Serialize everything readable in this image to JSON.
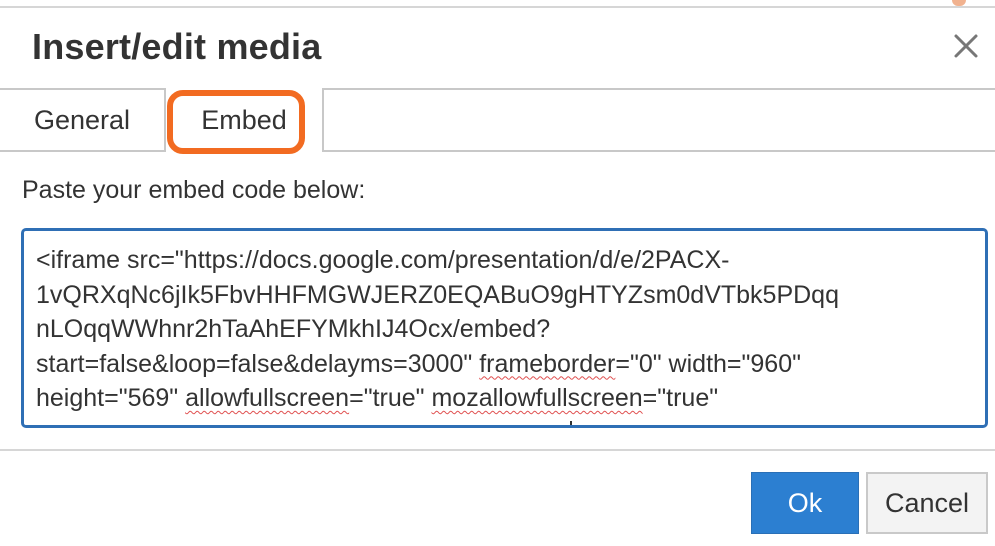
{
  "dialog": {
    "title": "Insert/edit media",
    "close_icon": "close-icon"
  },
  "tabs": [
    {
      "label": "General",
      "active": false
    },
    {
      "label": "Embed",
      "active": true
    }
  ],
  "embed": {
    "instruction": "Paste your embed code below:",
    "lines": {
      "l1": "<iframe src=\"https://docs.google.com/presentation/d/e/2PACX-",
      "l2": "1vQRXqNc6jIk5FbvHHFMGWJERZ0EQABuO9gHTYZsm0dVTbk5PDqq",
      "l3": "nLOqqWWhnr2hTaAhEFYMkhIJ4Ocx/embed?",
      "l4a": "start=false&loop=false&delayms=3000\" ",
      "l4b": "frameborder",
      "l4c": "=\"0\" width=\"960\"",
      "l5a": "height=\"569\" ",
      "l5b": "allowfullscreen",
      "l5c": "=\"true\" ",
      "l5d": "mozallowfullscreen",
      "l5e": "=\"true\""
    }
  },
  "buttons": {
    "ok": "Ok",
    "cancel": "Cancel"
  },
  "colors": {
    "primary": "#2c7fd1",
    "highlight": "#f26b21",
    "focus_border": "#2f6fb5"
  }
}
